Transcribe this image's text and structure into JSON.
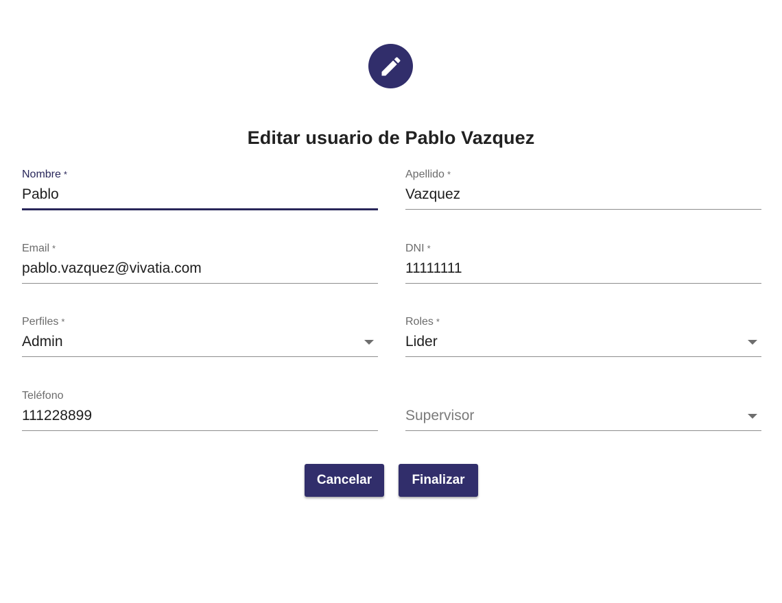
{
  "header": {
    "icon": "pencil-icon",
    "accent_color": "#312e6b",
    "title": "Editar usuario de Pablo Vazquez"
  },
  "form": {
    "nombre": {
      "label": "Nombre",
      "required_mark": "*",
      "value": "Pablo"
    },
    "apellido": {
      "label": "Apellido",
      "required_mark": "*",
      "value": "Vazquez"
    },
    "email": {
      "label": "Email",
      "required_mark": "*",
      "value": "pablo.vazquez@vivatia.com"
    },
    "dni": {
      "label": "DNI",
      "required_mark": "*",
      "value": "11111111"
    },
    "perfiles": {
      "label": "Perfiles",
      "required_mark": "*",
      "value": "Admin"
    },
    "roles": {
      "label": "Roles",
      "required_mark": "*",
      "value": "Lider"
    },
    "telefono": {
      "label": "Teléfono",
      "value": "111228899"
    },
    "supervisor": {
      "placeholder": "Supervisor"
    }
  },
  "actions": {
    "cancel_label": "Cancelar",
    "finish_label": "Finalizar"
  }
}
